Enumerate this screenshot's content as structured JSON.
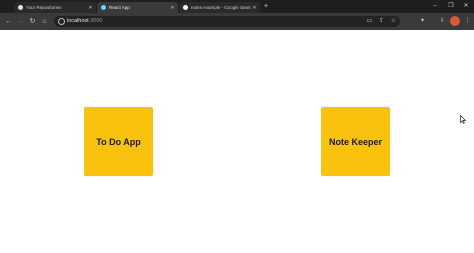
{
  "browser": {
    "tabs": [
      {
        "label": "Your Repositories",
        "favicon": "github-favicon",
        "active": false
      },
      {
        "label": "React App",
        "favicon": "react-favicon",
        "active": true
      },
      {
        "label": "notes example - Google Search",
        "favicon": "google-favicon",
        "active": false
      }
    ],
    "address": {
      "host": "localhost",
      "port": ":3000"
    },
    "colors": {
      "tabstrip": "#1f1f1f",
      "toolbar": "#3a3a3a",
      "omnibox": "#232323"
    }
  },
  "page": {
    "cards": [
      {
        "label": "To Do App"
      },
      {
        "label": "Note Keeper"
      }
    ],
    "card_color": "#f8c20e",
    "background": "#ffffff"
  }
}
